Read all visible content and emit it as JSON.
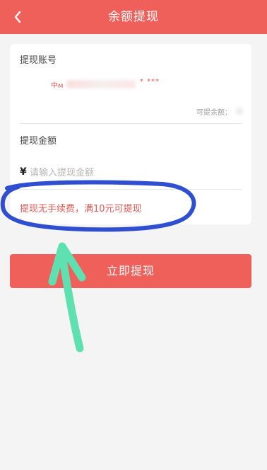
{
  "header": {
    "back_icon": "chevron-left-icon",
    "title": "余额提现"
  },
  "account": {
    "label": "提现账号",
    "value_start": "中м",
    "value_mask": "* ***",
    "balance_label": "可提余额："
  },
  "amount": {
    "label": "提现金额",
    "currency": "¥",
    "placeholder": "请输入提现金额"
  },
  "notice": "提现无手续费，满10元可提现",
  "submit_label": "立即提现",
  "colors": {
    "brand": "#f0605a",
    "notice_text": "#e05a55",
    "annotation_circle": "#2f4fd0",
    "annotation_arrow": "#5fe0b0"
  }
}
